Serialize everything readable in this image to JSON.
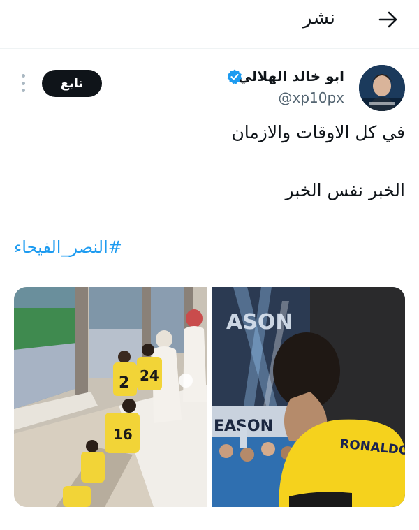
{
  "header": {
    "title": "نشر",
    "back_icon": "arrow-right-icon"
  },
  "author": {
    "name": "ابو خالد الهلالي",
    "handle": "@xp10px",
    "verified_icon": "verified-badge-icon",
    "verified_color": "#1d9bf0"
  },
  "actions": {
    "follow_label": "تابع",
    "more_icon": "more-vertical-icon"
  },
  "tweet": {
    "line1": "في كل الاوقات والازمان",
    "line2": "الخبر نفس الخبر",
    "hashtag": "#النصر_الفيحاء"
  },
  "media": {
    "count": 2,
    "photo_left_description_icon": "stairway-players-photo",
    "photo_right_text": "ASON",
    "photo_right_text2": "EASON",
    "jersey_name": "RONALDO",
    "jersey_numbers": [
      "2",
      "24",
      "16"
    ]
  },
  "colors": {
    "accent": "#1d9bf0",
    "button_dark": "#0f1419",
    "muted": "#536471"
  }
}
